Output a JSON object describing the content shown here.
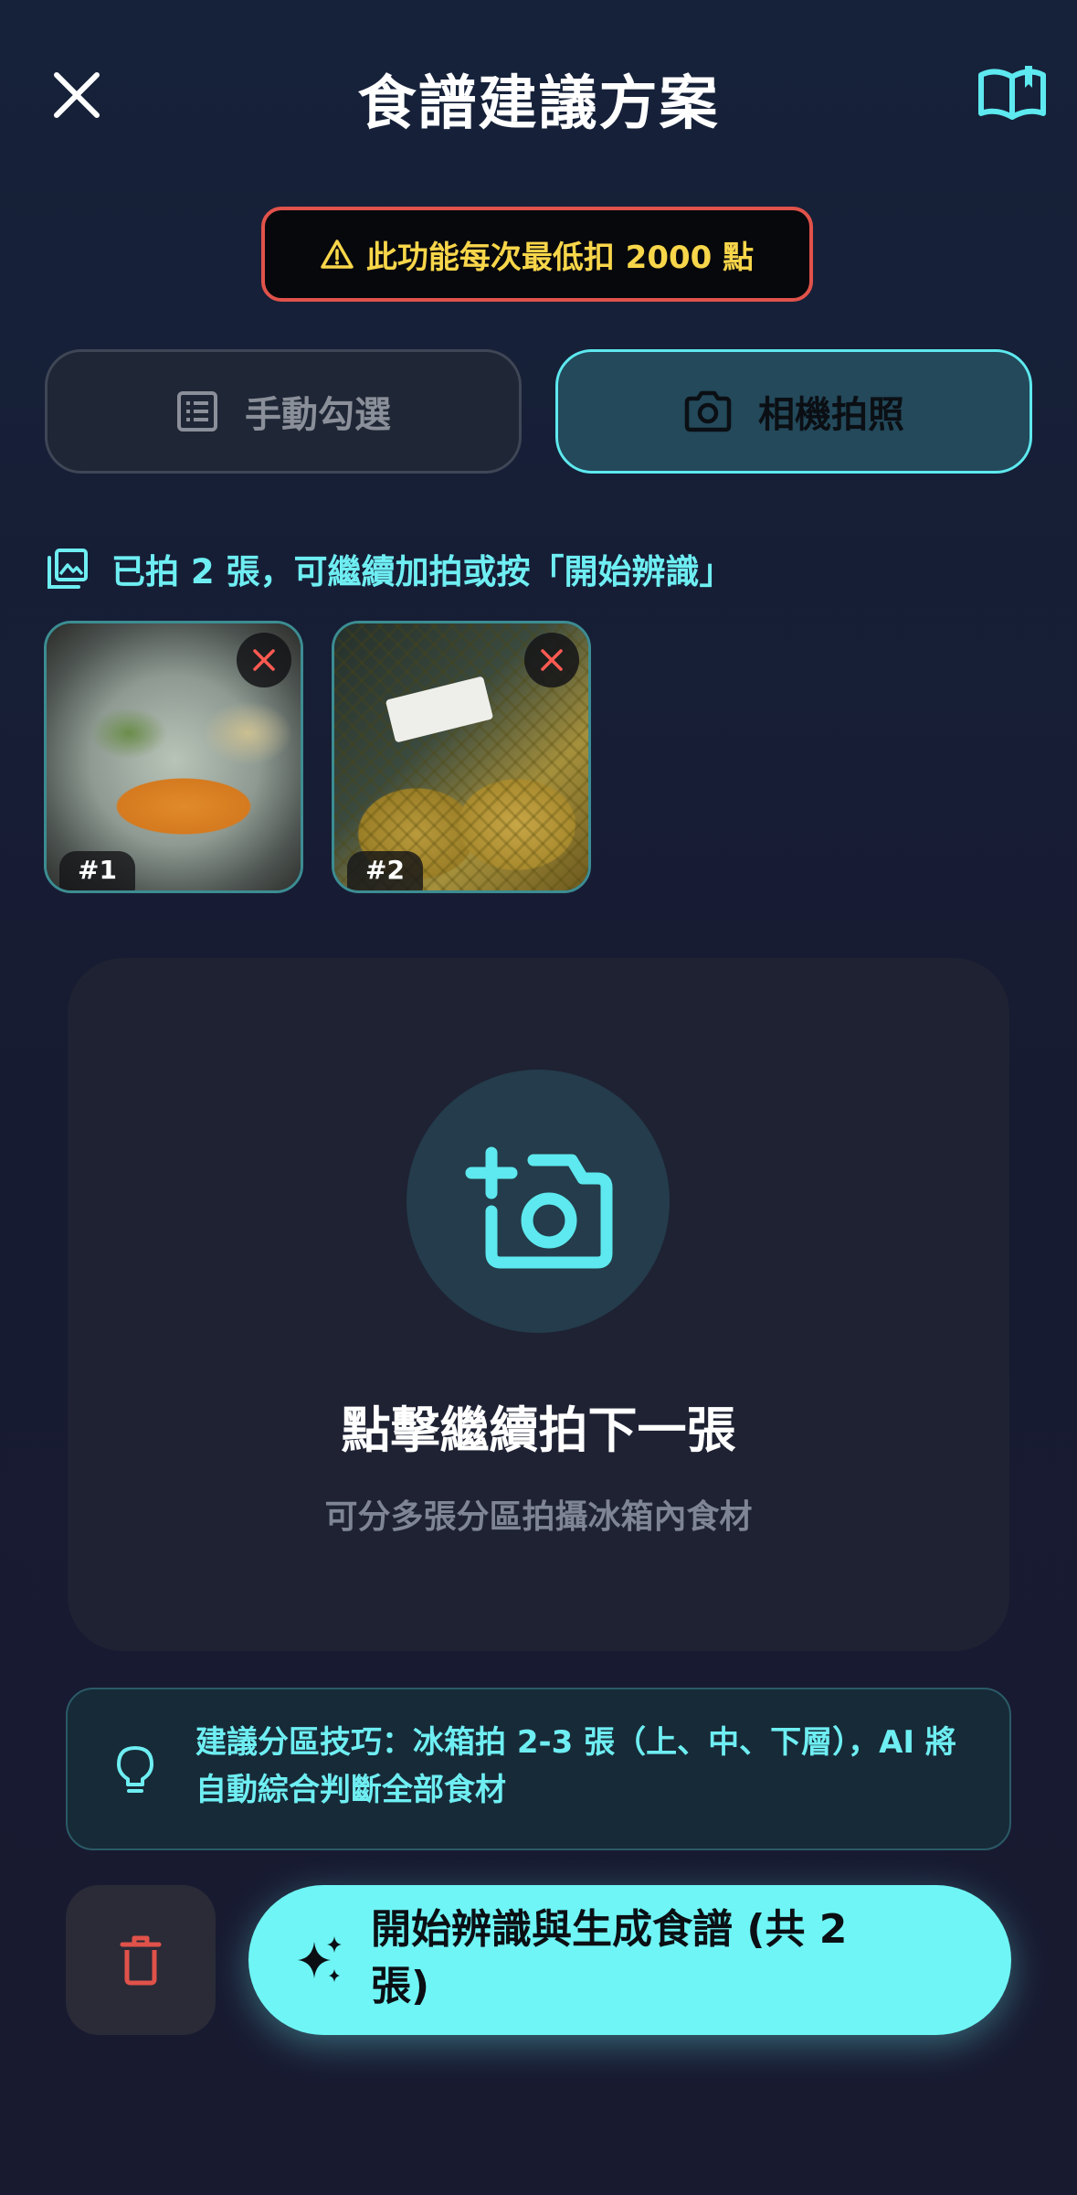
{
  "header": {
    "title": "食譜建議方案"
  },
  "warning": {
    "text": "此功能每次最低扣 2000 點",
    "color": "#f8d64a",
    "border_color": "#e0524a"
  },
  "mode_toggle": {
    "manual_label": "手動勾選",
    "camera_label": "相機拍照",
    "selected": "camera"
  },
  "photos": {
    "count_text": "已拍 2 張，可繼續加拍或按「開始辨識」",
    "items": [
      {
        "num": "#1"
      },
      {
        "num": "#2"
      }
    ]
  },
  "capture": {
    "title": "點擊繼續拍下一張",
    "subtitle": "可分多張分區拍攝冰箱內食材"
  },
  "tip": {
    "text": "建議分區技巧：冰箱拍 2-3 張（上、中、下層），AI 將自動綜合判斷全部食材"
  },
  "actions": {
    "start_label": "開始辨識與生成食譜 (共 2 張)"
  },
  "colors": {
    "accent": "#6ff5f5",
    "danger": "#e0524a",
    "background": "#171b32"
  },
  "icons": [
    "close-icon",
    "book-icon",
    "warning-icon",
    "list-icon",
    "camera-icon",
    "gallery-icon",
    "remove-icon",
    "add-camera-icon",
    "lightbulb-icon",
    "trash-icon",
    "sparkle-icon"
  ]
}
